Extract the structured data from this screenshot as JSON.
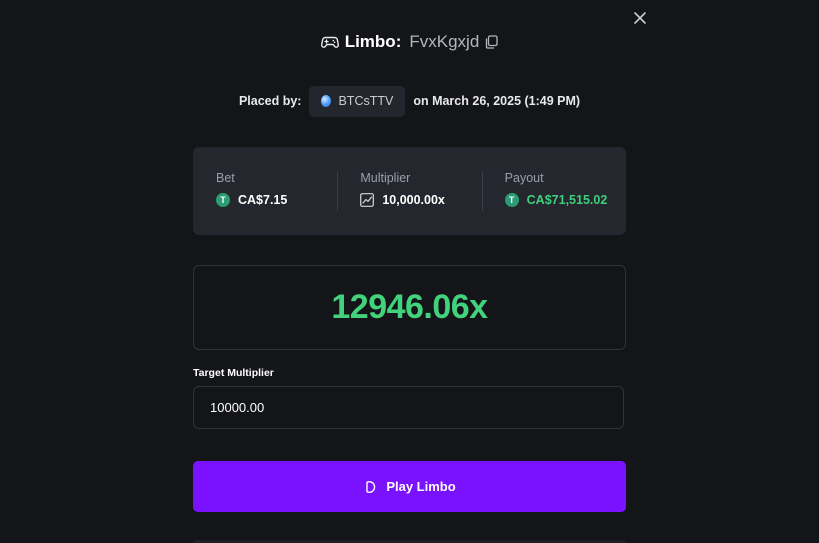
{
  "header": {
    "game_name": "Limbo:",
    "bet_id": "FvxKgxjd",
    "game_icon": "gamepad-icon",
    "copy_icon": "copy-icon",
    "close_icon": "close-icon"
  },
  "placed_by": {
    "label": "Placed by:",
    "username": "BTCsTTV",
    "date_text": "on March 26, 2025 (1:49 PM)"
  },
  "stats": {
    "bet": {
      "label": "Bet",
      "value": "CA$7.15",
      "currency_glyph": "T"
    },
    "multiplier": {
      "label": "Multiplier",
      "value": "10,000.00x",
      "icon": "trend-chart-icon"
    },
    "payout": {
      "label": "Payout",
      "value": "CA$71,515.02",
      "currency_glyph": "T"
    }
  },
  "result": {
    "value": "12946.06x"
  },
  "target": {
    "label": "Target Multiplier",
    "value": "10000.00"
  },
  "play_button": {
    "label": "Play Limbo",
    "icon": "limbo-icon"
  },
  "colors": {
    "background": "#141518",
    "card": "#24272d",
    "accent_purple": "#7a12ff",
    "win_green": "#43d27c",
    "currency_green": "#2a9d73"
  }
}
